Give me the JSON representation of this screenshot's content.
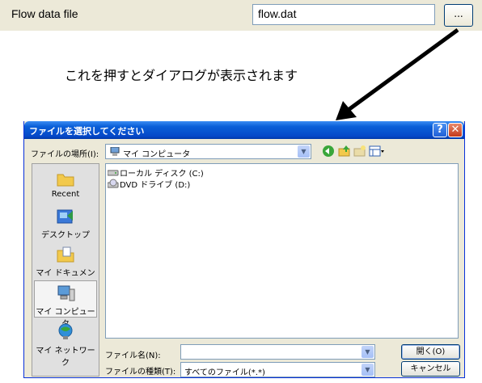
{
  "top": {
    "label": "Flow data file",
    "value": "flow.dat",
    "browse_label": "..."
  },
  "caption": "これを押すとダイアログが表示されます",
  "dialog": {
    "title": "ファイルを選択してください",
    "help_label": "?",
    "close_label": "✕",
    "look_in_label": "ファイルの場所(I):",
    "look_in_value": "マイ コンピュータ",
    "places": [
      {
        "label": "Recent",
        "icon": "recent-folder-icon"
      },
      {
        "label": "デスクトップ",
        "icon": "desktop-icon"
      },
      {
        "label": "マイ ドキュメント",
        "icon": "my-documents-icon"
      },
      {
        "label": "マイ コンピュータ",
        "icon": "my-computer-icon"
      },
      {
        "label": "マイ ネットワーク",
        "icon": "my-network-icon"
      }
    ],
    "files": [
      {
        "label": "ローカル ディスク (C:)",
        "icon": "local-disk-icon"
      },
      {
        "label": "DVD ドライブ (D:)",
        "icon": "dvd-drive-icon"
      }
    ],
    "file_name_label": "ファイル名(N):",
    "file_name_value": "",
    "file_type_label": "ファイルの種類(T):",
    "file_type_value": "すべてのファイル(*.*)",
    "open_label": "開く(O)",
    "cancel_label": "キャンセル"
  }
}
